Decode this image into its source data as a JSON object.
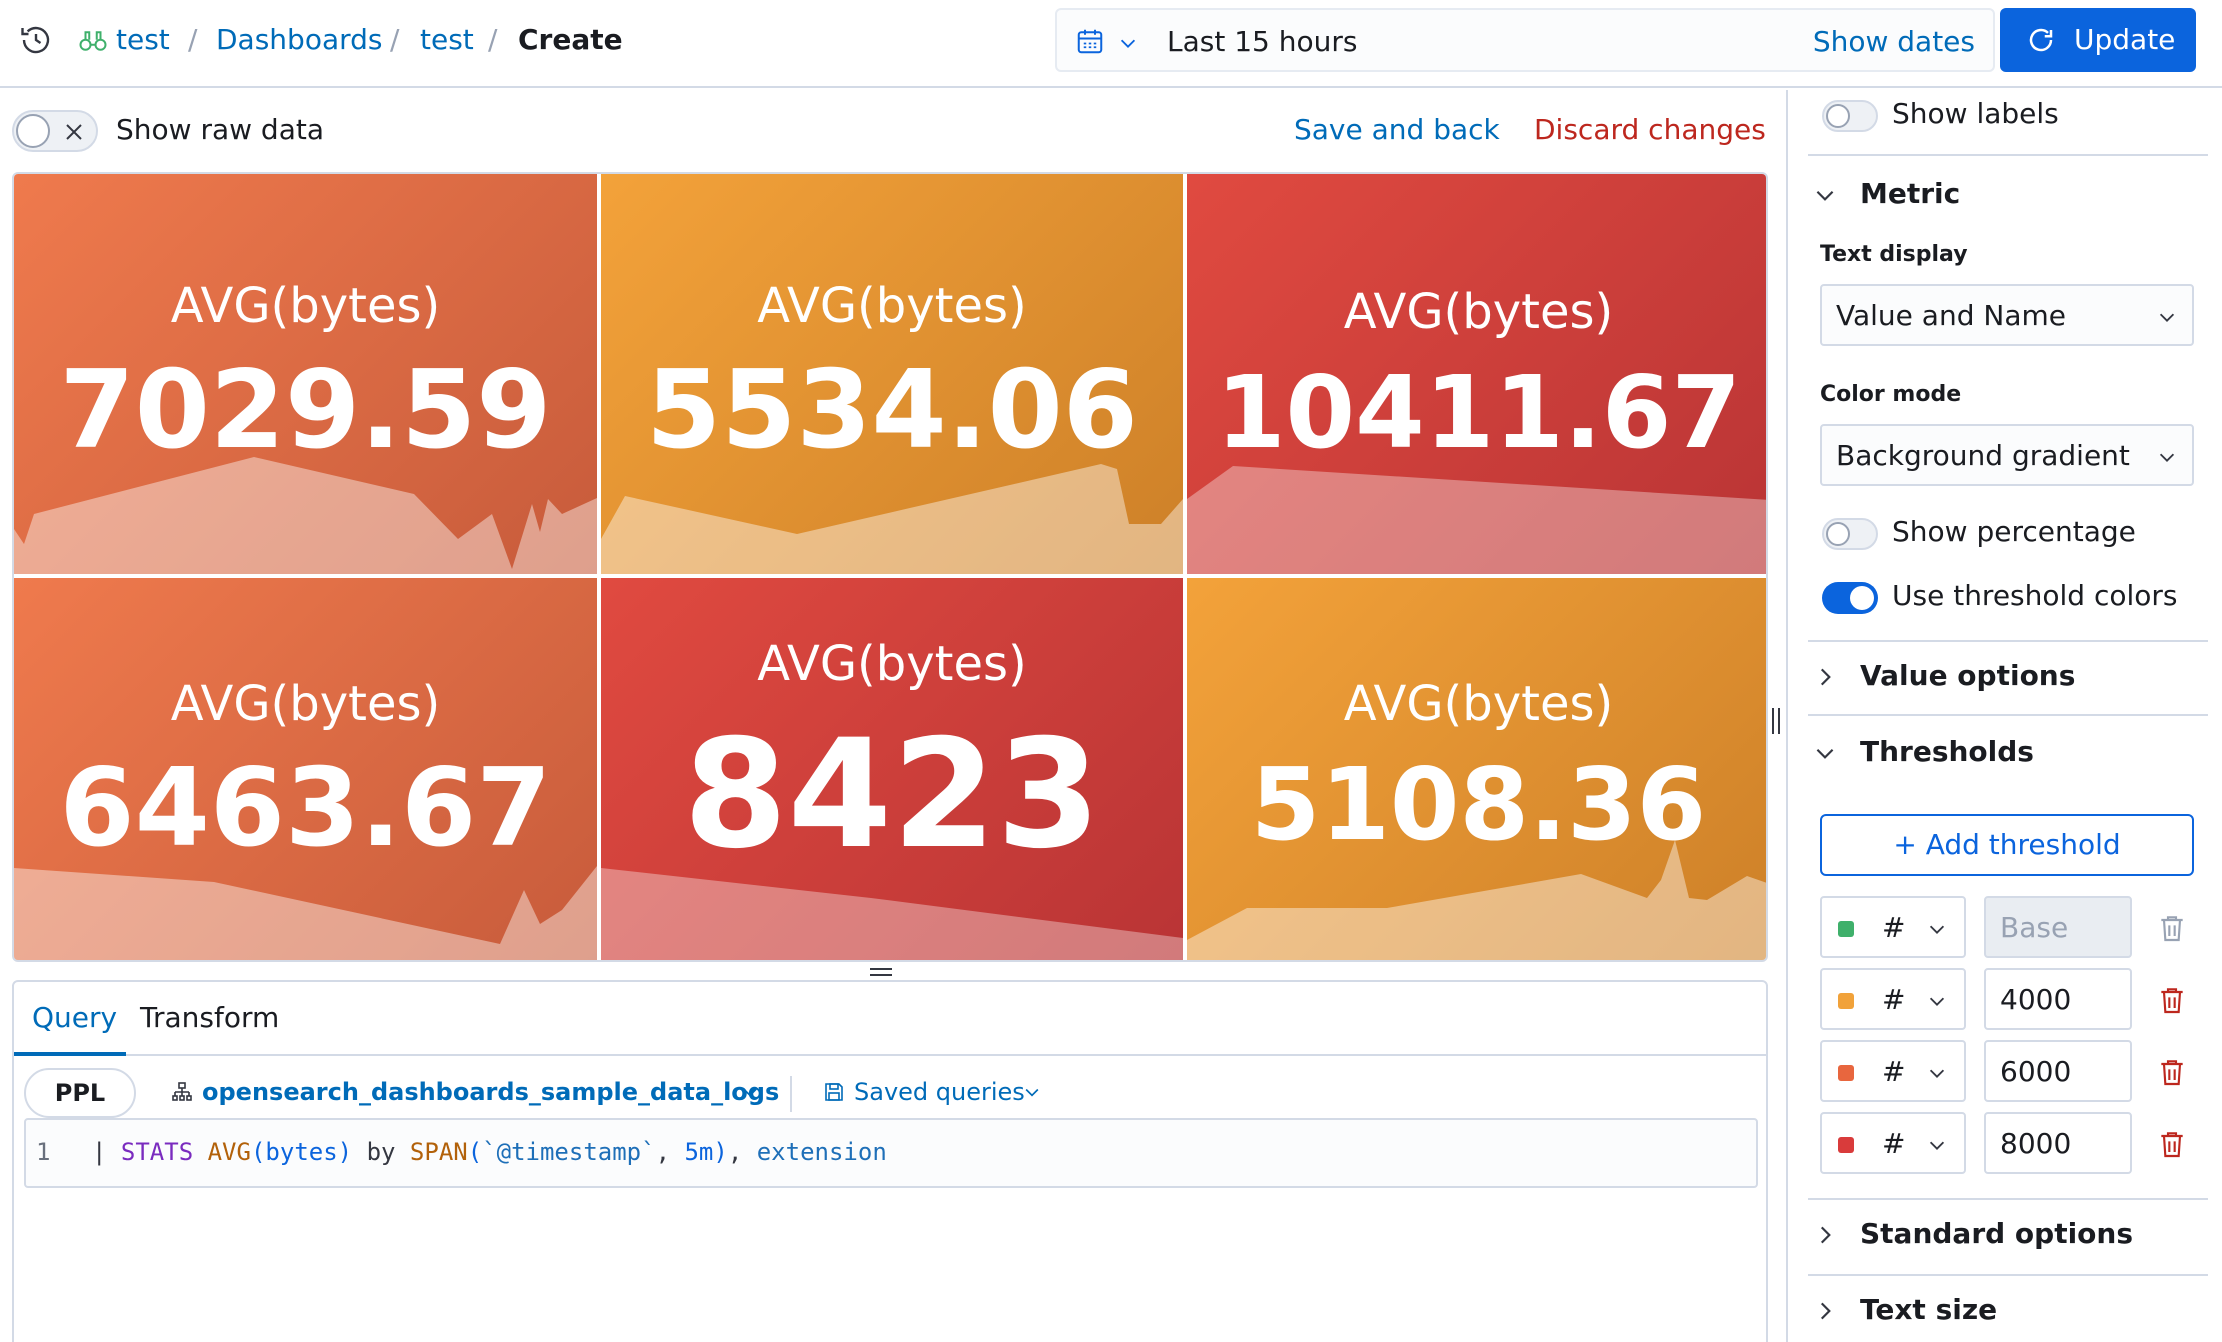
{
  "header": {
    "breadcrumbs": [
      "test",
      "Dashboards",
      "test"
    ],
    "current": "Create",
    "separator": "/",
    "date_range": "Last 15 hours",
    "show_dates": "Show dates",
    "update": "Update"
  },
  "toolbar": {
    "show_raw": "Show raw data",
    "save_back": "Save and back",
    "discard": "Discard changes"
  },
  "metrics": [
    {
      "label": "AVG(bytes)",
      "value": "7029.59",
      "color": "#e8663e"
    },
    {
      "label": "AVG(bytes)",
      "value": "5534.06",
      "color": "#ec9a35"
    },
    {
      "label": "AVG(bytes)",
      "value": "10411.67",
      "color": "#d93b3b"
    },
    {
      "label": "AVG(bytes)",
      "value": "6463.67",
      "color": "#e8663e"
    },
    {
      "label": "AVG(bytes)",
      "value": "8423",
      "color": "#d93b3b"
    },
    {
      "label": "AVG(bytes)",
      "value": "5108.36",
      "color": "#ec9a35"
    }
  ],
  "query": {
    "tabs": [
      "Query",
      "Transform"
    ],
    "language": "PPL",
    "datasource": "opensearch_dashboards_sample_data_logs",
    "saved_queries": "Saved queries",
    "line_number": "1",
    "code": {
      "pipe": "| ",
      "stats": "STATS",
      "avg": "AVG",
      "arg1": "(bytes)",
      "by": " by ",
      "span": "SPAN",
      "open": "(",
      "ts": "`@timestamp`",
      "comma1": ", ",
      "interval": "5m)",
      "comma2": ", ",
      "ext": "extension"
    }
  },
  "sidebar": {
    "show_labels": "Show labels",
    "metric_title": "Metric",
    "text_display_label": "Text display",
    "text_display_value": "Value and Name",
    "color_mode_label": "Color mode",
    "color_mode_value": "Background gradient",
    "show_percentage": "Show percentage",
    "use_threshold_colors": "Use threshold colors",
    "value_options": "Value options",
    "thresholds_title": "Thresholds",
    "add_threshold": "+ Add threshold",
    "thresholds": [
      {
        "color": "#3fb06b",
        "hash": "#",
        "value": "Base"
      },
      {
        "color": "#f1a23a",
        "hash": "#",
        "value": "4000"
      },
      {
        "color": "#e8663e",
        "hash": "#",
        "value": "6000"
      },
      {
        "color": "#d93b3b",
        "hash": "#",
        "value": "8000"
      }
    ],
    "standard_options": "Standard options",
    "text_size": "Text size"
  }
}
